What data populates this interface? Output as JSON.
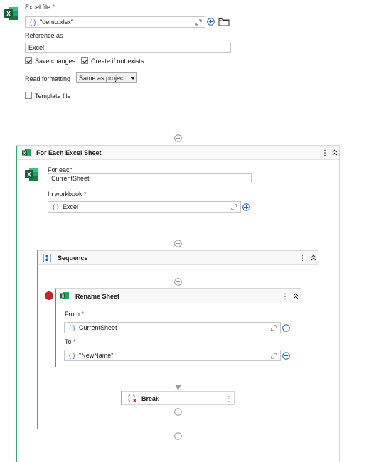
{
  "excel_scope": {
    "file_label": "Excel file",
    "required_mark": "*",
    "file_value": "\"demo.xlsx\"",
    "reference_label": "Reference as",
    "reference_value": "Excel",
    "save_changes_label": "Save changes",
    "save_changes_checked": true,
    "create_if_not_exists_label": "Create if not exists",
    "create_if_not_exists_checked": true,
    "read_formatting_label": "Read formatting",
    "read_formatting_value": "Same as project",
    "template_file_label": "Template file",
    "template_file_checked": false
  },
  "for_each": {
    "title": "For Each Excel Sheet",
    "for_each_label": "For each",
    "for_each_value": "CurrentSheet",
    "in_workbook_label": "In workbook",
    "in_workbook_value": "Excel"
  },
  "sequence": {
    "title": "Sequence"
  },
  "rename_sheet": {
    "title": "Rename Sheet",
    "from_label": "From",
    "from_value": "CurrentSheet",
    "to_label": "To",
    "to_value": "\"NewName\""
  },
  "break_activity": {
    "title": "Break"
  },
  "colors": {
    "excel_green": "#1d7044",
    "accent_blue": "#1f5fd1",
    "breakpoint_red": "#c0272d",
    "container_green": "#3aa56a",
    "break_accent": "#e0a030"
  },
  "icons": [
    "excel-icon",
    "folder-icon",
    "plus-circle-icon",
    "expand-icon",
    "kebab-icon",
    "collapse-icon",
    "sequence-icon",
    "break-icon",
    "breakpoint-icon"
  ]
}
